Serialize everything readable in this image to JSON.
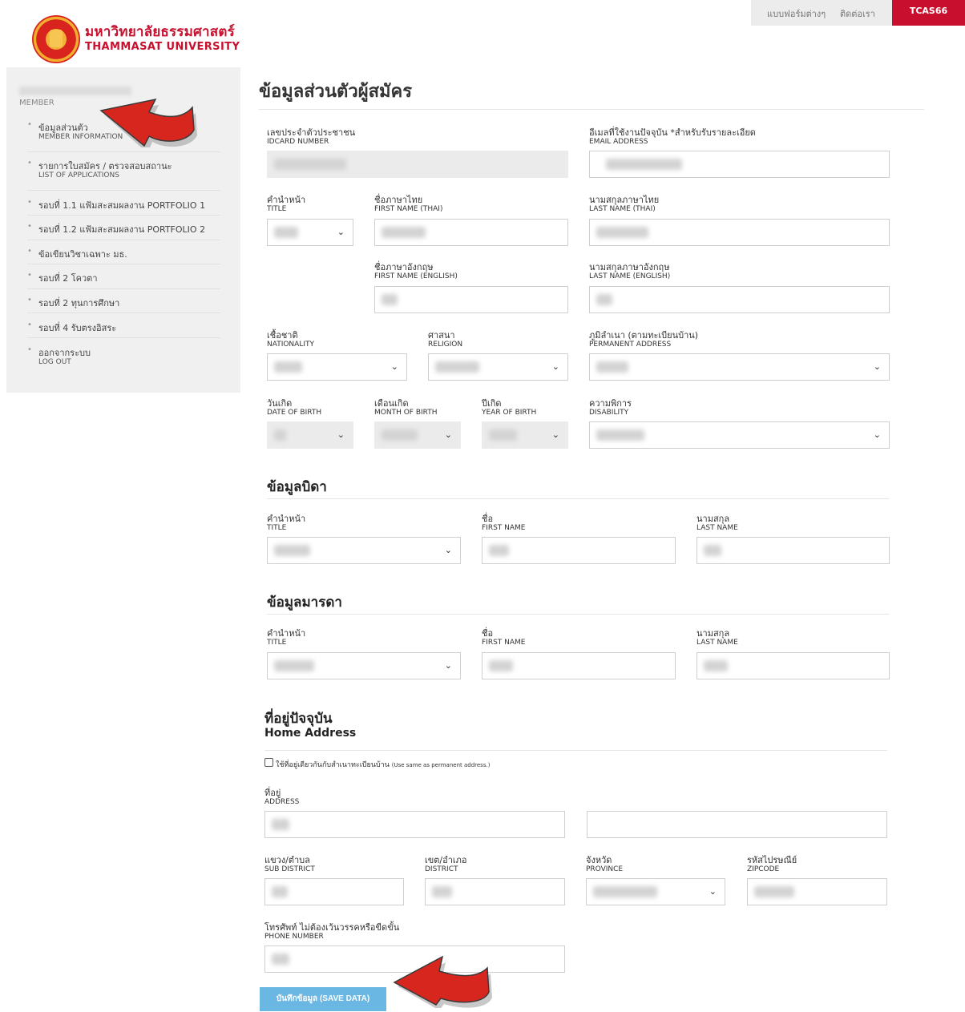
{
  "header": {
    "links": [
      "แบบฟอร์มต่างๆ",
      "ติดต่อเรา"
    ],
    "tcas_label": "TCAS66",
    "logo_thai": "มหาวิทยาลัยธรรมศาสตร์",
    "logo_eng": "THAMMASAT UNIVERSITY"
  },
  "sidebar": {
    "member_label": "MEMBER",
    "items": [
      {
        "label": "ข้อมูลส่วนตัว",
        "sub": "MEMBER INFORMATION"
      },
      {
        "label": "รายการใบสมัคร / ตรวจสอบสถานะ",
        "sub": "LIST OF APPLICATIONS"
      },
      {
        "label": "รอบที่ 1.1 แฟ้มสะสมผลงาน PORTFOLIO 1",
        "sub": ""
      },
      {
        "label": "รอบที่ 1.2 แฟ้มสะสมผลงาน PORTFOLIO 2",
        "sub": ""
      },
      {
        "label": "ข้อเขียนวิชาเฉพาะ มธ.",
        "sub": ""
      },
      {
        "label": "รอบที่ 2 โควตา",
        "sub": ""
      },
      {
        "label": "รอบที่ 2 ทุนการศึกษา",
        "sub": ""
      },
      {
        "label": "รอบที่ 4 รับตรงอิสระ",
        "sub": ""
      },
      {
        "label": "ออกจากระบบ",
        "sub": "LOG OUT"
      }
    ]
  },
  "main": {
    "title": "ข้อมูลส่วนตัวผู้สมัคร",
    "labels": {
      "idcard": {
        "th": "เลขประจำตัวประชาชน",
        "en": "IDCARD NUMBER"
      },
      "email": {
        "th": "อีเมลที่ใช้งานปัจจุบัน *สำหรับรับรายละเอียด",
        "en": "EMAIL ADDRESS"
      },
      "title": {
        "th": "คำนำหน้า",
        "en": "TITLE"
      },
      "first_thai": {
        "th": "ชื่อภาษาไทย",
        "en": "FIRST NAME (THAI)"
      },
      "last_thai": {
        "th": "นามสกุลภาษาไทย",
        "en": "LAST NAME (THAI)"
      },
      "first_eng": {
        "th": "ชื่อภาษาอังกฤษ",
        "en": "FIRST NAME (ENGLISH)"
      },
      "last_eng": {
        "th": "นามสกุลภาษาอังกฤษ",
        "en": "LAST NAME (ENGLISH)"
      },
      "nationality": {
        "th": "เชื้อชาติ",
        "en": "NATIONALITY"
      },
      "religion": {
        "th": "ศาสนา",
        "en": "RELIGION"
      },
      "permanent": {
        "th": "ภูมิลำเนา (ตามทะเบียนบ้าน)",
        "en": "PERMANENT ADDRESS"
      },
      "dob": {
        "th": "วันเกิด",
        "en": "DATE OF BIRTH"
      },
      "mob": {
        "th": "เดือนเกิด",
        "en": "MONTH OF BIRTH"
      },
      "yob": {
        "th": "ปีเกิด",
        "en": "YEAR OF BIRTH"
      },
      "disability": {
        "th": "ความพิการ",
        "en": "DISABILITY"
      },
      "parent_first": {
        "th": "ชื่อ",
        "en": "FIRST NAME"
      },
      "parent_last": {
        "th": "นามสกุล",
        "en": "LAST NAME"
      },
      "address": {
        "th": "ที่อยู่",
        "en": "ADDRESS"
      },
      "subdistrict": {
        "th": "แขวง/ตำบล",
        "en": "SUB DISTRICT"
      },
      "district": {
        "th": "เขต/อำเภอ",
        "en": "DISTRICT"
      },
      "province": {
        "th": "จังหวัด",
        "en": "PROVINCE"
      },
      "zipcode": {
        "th": "รหัสไปรษณีย์",
        "en": "ZIPCODE"
      },
      "phone": {
        "th": "โทรศัพท์ ไม่ต้องเว้นวรรคหรือขีดขั้น",
        "en": "PHONE NUMBER"
      }
    },
    "father_title": "ข้อมูลบิดา",
    "mother_title": "ข้อมูลมารดา",
    "home_title": "ที่อยู่ปัจจุบัน",
    "home_subtitle": "Home Address",
    "same_address_label": "ใช้ที่อยู่เดียวกันกับสำเนาทะเบียนบ้าน",
    "same_address_note": "(Use same as permanent address.)",
    "save_label": "บันทึกข้อมูล (SAVE DATA)"
  },
  "icons": {
    "chevron": "chevron-down-icon",
    "arrow": "red-arrow-pointer-icon"
  },
  "colors": {
    "brand": "#c8102e",
    "save_button": "#6bb7e4",
    "arrow": "#d7261e"
  }
}
